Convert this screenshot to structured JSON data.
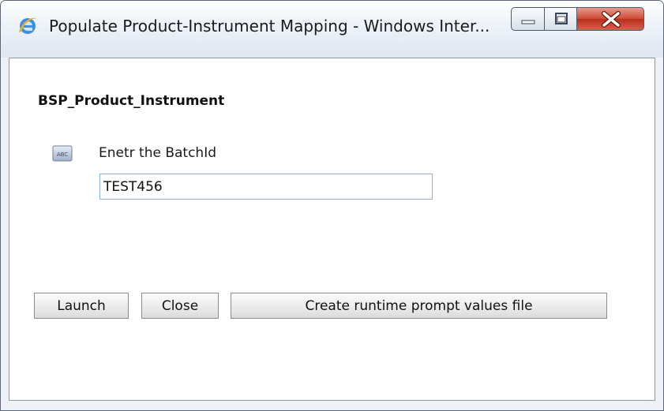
{
  "window": {
    "title": "Populate Product-Instrument Mapping - Windows Inter...",
    "app_icon": "internet-explorer-icon",
    "controls": [
      "minimize-icon",
      "maximize-icon",
      "close-icon"
    ]
  },
  "form": {
    "heading": "BSP_Product_Instrument",
    "prompt_icon": "abc-text-icon",
    "prompt_label": "Enetr the BatchId",
    "batch_id_value": "TEST456"
  },
  "buttons": {
    "launch": "Launch",
    "close": "Close",
    "create_file": "Create runtime prompt values file"
  },
  "colors": {
    "close_button": "#cf4d36",
    "input_border": "#8fb3d9"
  }
}
